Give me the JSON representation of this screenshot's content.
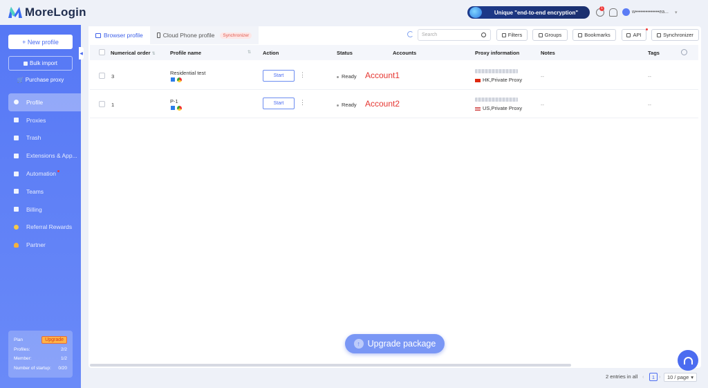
{
  "app": {
    "name": "MoreLogin"
  },
  "topbar": {
    "promo_text": "Unique \"end-to-end encryption\"",
    "notification_count": "1",
    "user_name": "w••••••••••••••ea..."
  },
  "sidebar": {
    "new_profile": "+ New profile",
    "bulk_import": "Bulk import",
    "purchase_proxy": "Purchase proxy",
    "items": [
      {
        "label": "Profile",
        "icon": "profile-icon",
        "active": true
      },
      {
        "label": "Proxies",
        "icon": "proxies-icon"
      },
      {
        "label": "Trash",
        "icon": "trash-icon"
      },
      {
        "label": "Extensions & App...",
        "icon": "extensions-icon"
      },
      {
        "label": "Automation",
        "icon": "automation-icon"
      },
      {
        "label": "Teams",
        "icon": "teams-icon"
      },
      {
        "label": "Billing",
        "icon": "billing-icon"
      },
      {
        "label": "Referral Rewards",
        "icon": "coin-icon"
      },
      {
        "label": "Partner",
        "icon": "heart-icon"
      }
    ],
    "plan": {
      "label": "Plan",
      "upgrade": "Upgrade",
      "profiles_label": "Profiles:",
      "profiles_value": "2/2",
      "member_label": "Member:",
      "member_value": "1/2",
      "startup_label": "Number of startup:",
      "startup_value": "0/20"
    }
  },
  "tabs": [
    {
      "label": "Browser profile",
      "active": true
    },
    {
      "label": "Cloud Phone profile",
      "tag": "Synchronizer"
    }
  ],
  "toolbar": {
    "search_placeholder": "Search",
    "filters": "Filters",
    "groups": "Groups",
    "bookmarks": "Bookmarks",
    "api": "API",
    "synchronizer": "Synchronizer"
  },
  "table": {
    "headers": {
      "order": "Numerical order",
      "name": "Profile name",
      "action": "Action",
      "status": "Status",
      "accounts": "Accounts",
      "proxy": "Proxy information",
      "notes": "Notes",
      "tags": "Tags"
    },
    "rows": [
      {
        "order": "3",
        "name": "Residential test",
        "action": "Start",
        "status": "Ready",
        "account": "Account1",
        "proxy": "HK,Private Proxy",
        "notes": "--",
        "tags": "--"
      },
      {
        "order": "1",
        "name": "P-1",
        "action": "Start",
        "status": "Ready",
        "account": "Account2",
        "proxy": "US,Private Proxy",
        "notes": "--",
        "tags": "--"
      }
    ]
  },
  "upgrade_package": "Upgrade package",
  "pagination": {
    "summary": "2 entries in all",
    "current_page": "1",
    "page_size": "10 / page"
  },
  "colors": {
    "accent": "#4b6cf0",
    "sidebar": "#5678f5",
    "annotation": "#e53530"
  }
}
